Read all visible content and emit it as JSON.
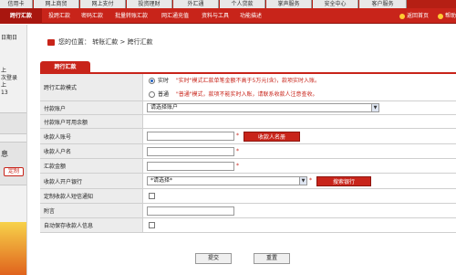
{
  "top_tabs": [
    "信用卡",
    "网上商贸",
    "网上支付",
    "投资理财",
    "外汇通",
    "个人贷款",
    "掌声服务",
    "安全中心",
    "客户服务"
  ],
  "nav": {
    "active": "跨行汇款",
    "items": [
      "投跨汇款",
      "密码汇款",
      "批量转账汇款",
      "网汇通充值",
      "资料与工具",
      "功能描述"
    ],
    "back_home": "返回首页",
    "help": "帮助"
  },
  "sidebar": {
    "date_label": "日期日",
    "login_text": [
      "上",
      "次登录",
      "上",
      "13"
    ],
    "section": "息",
    "button": "定制"
  },
  "breadcrumb": {
    "prefix": "您的位置：",
    "path": "转账汇款 > 跨行汇款"
  },
  "section_tab": "跨行汇款",
  "form": {
    "mode_label": "跨行汇款模式",
    "mode_realtime": "实时",
    "mode_realtime_note": "\"实时\"模式汇款单笔金额不高于5万元(含)，款项实时入账。",
    "mode_normal": "普通",
    "mode_normal_note": "\"普通\"模式，款项不能实时入账，请联系收款人注意查收。",
    "pay_account_label": "付款账户",
    "pay_account_value": "请选择账户",
    "available_label": "付款账户可用余额",
    "payee_account_label": "收款人账号",
    "payee_list_button": "收款人名册",
    "payee_name_label": "收款人户名",
    "amount_label": "汇款金额",
    "bank_label": "收款人开户银行",
    "bank_value": "*请选择*",
    "search_bank_button": "搜索银行",
    "sms_label": "定制收款人短信通知",
    "note_label": "附言",
    "auto_save_label": "自动保存收款人信息",
    "required_mark": "*"
  },
  "buttons": {
    "submit": "提交",
    "reset": "重置"
  }
}
